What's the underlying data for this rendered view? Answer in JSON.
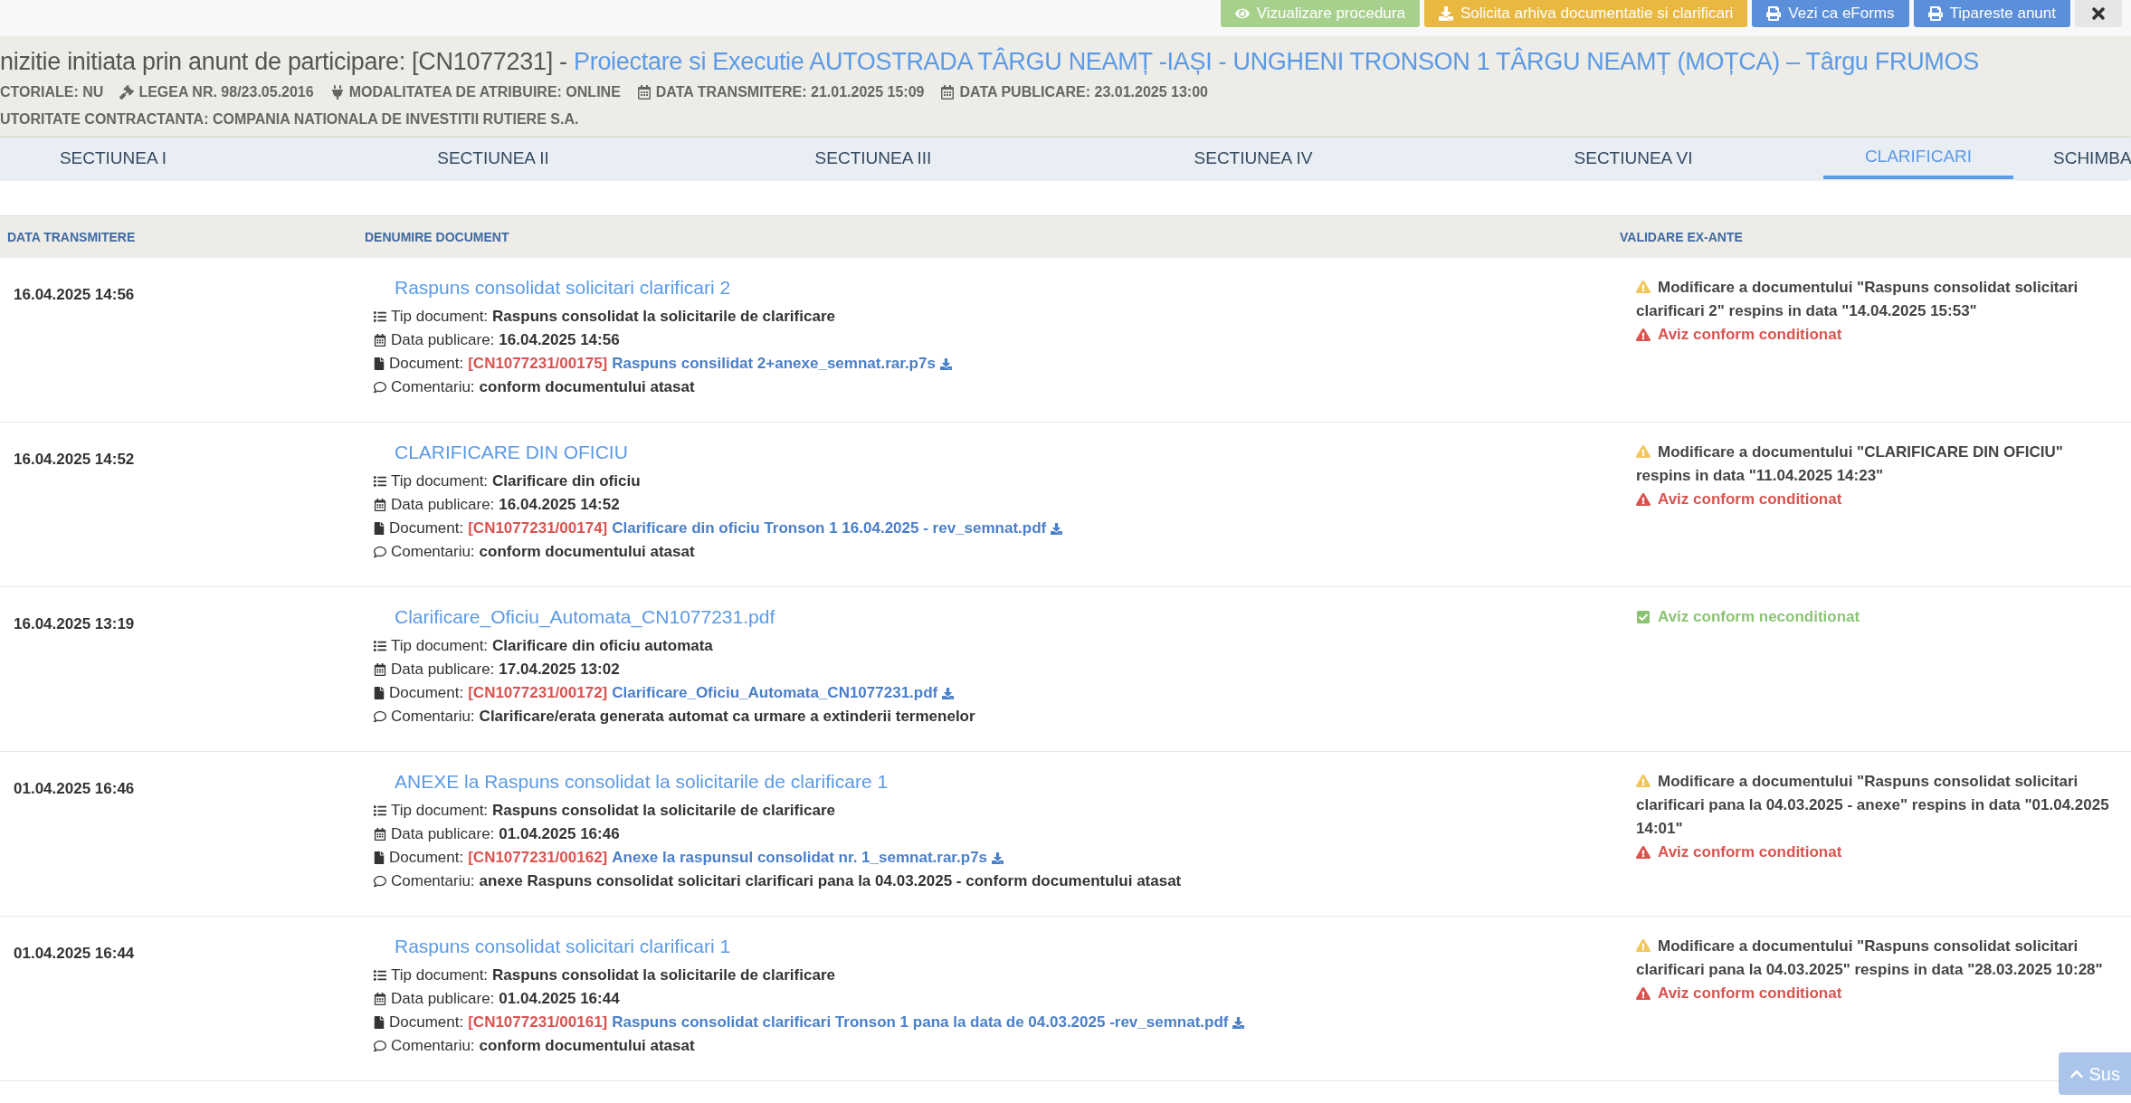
{
  "top_buttons": [
    {
      "kind": "view",
      "label": "Vizualizare procedura",
      "color": "#a8d08d"
    },
    {
      "kind": "archive",
      "label": "Solicita arhiva documentatie si clarificari",
      "color": "#e9b841"
    },
    {
      "kind": "print",
      "label": "Vezi ca eForms",
      "color": "#5b8fd9"
    },
    {
      "kind": "print",
      "label": "Tipareste anunt",
      "color": "#5b8fd9"
    },
    {
      "kind": "close",
      "color": "#e6e6e6"
    }
  ],
  "header": {
    "title_prefix": "nizitie initiata prin anunt de participare: [CN1077231] -",
    "title_link": "Proiectare si Executie AUTOSTRADA TÂRGU NEAMȚ -IAȘI - UNGHENI TRONSON 1 TÂRGU NEAMȚ (MOȚCA) – Târgu FRUMOS",
    "meta": [
      {
        "kind": "plain",
        "text": "CTORIALE: NU"
      },
      {
        "kind": "law",
        "text": "LEGEA NR. 98/23.05.2016"
      },
      {
        "kind": "plug",
        "text": "MODALITATEA DE ATRIBUIRE: ONLINE"
      },
      {
        "kind": "date",
        "text": "DATA TRANSMITERE: 21.01.2025 15:09"
      },
      {
        "kind": "date",
        "text": "DATA PUBLICARE: 23.01.2025 13:00"
      }
    ],
    "authority": "UTORITATE CONTRACTANTA: COMPANIA NATIONALA DE INVESTITII RUTIERE S.A."
  },
  "tabs": [
    {
      "label": "SECTIUNEA I",
      "selected": false
    },
    {
      "label": "SECTIUNEA II",
      "selected": false
    },
    {
      "label": "SECTIUNEA III",
      "selected": false
    },
    {
      "label": "SECTIUNEA IV",
      "selected": false
    },
    {
      "label": "SECTIUNEA VI",
      "selected": false
    },
    {
      "label": "CLARIFICARI",
      "selected": true
    },
    {
      "label": "SCHIMBA",
      "selected": false
    }
  ],
  "table": {
    "columns": [
      "DATA TRANSMITERE",
      "DENUMIRE DOCUMENT",
      "VALIDARE EX-ANTE"
    ],
    "rows": [
      {
        "date": "16.04.2025 14:56",
        "title": "Raspuns consolidat solicitari clarificari 2",
        "tip_label": "Tip document:",
        "tip": "Raspuns consolidat la solicitarile de clarificare",
        "pub_label": "Data publicare:",
        "pub": "16.04.2025 14:56",
        "doc_label": "Document:",
        "doc_code": "[CN1077231/00175]",
        "doc_name": "Raspuns consilidat 2+anexe_semnat.rar.p7s",
        "comment_label": "Comentariu:",
        "comment": "conform documentului atasat",
        "validation": [
          {
            "kind": "warning",
            "text": "Modificare a documentului \"Raspuns consolidat solicitari clarificari 2\" respins in data \"14.04.2025 15:53\""
          },
          {
            "kind": "error",
            "text": "Aviz conform conditionat"
          }
        ]
      },
      {
        "date": "16.04.2025 14:52",
        "title": "CLARIFICARE DIN OFICIU",
        "tip_label": "Tip document:",
        "tip": "Clarificare din oficiu",
        "pub_label": "Data publicare:",
        "pub": "16.04.2025 14:52",
        "doc_label": "Document:",
        "doc_code": "[CN1077231/00174]",
        "doc_name": "Clarificare din oficiu Tronson 1 16.04.2025 - rev_semnat.pdf",
        "comment_label": "Comentariu:",
        "comment": "conform documentului atasat",
        "validation": [
          {
            "kind": "warning",
            "text": "Modificare a documentului \"CLARIFICARE DIN OFICIU\" respins in data \"11.04.2025 14:23\""
          },
          {
            "kind": "error",
            "text": "Aviz conform conditionat"
          }
        ]
      },
      {
        "date": "16.04.2025 13:19",
        "title": "Clarificare_Oficiu_Automata_CN1077231.pdf",
        "tip_label": "Tip document:",
        "tip": "Clarificare din oficiu automata",
        "pub_label": "Data publicare:",
        "pub": "17.04.2025 13:02",
        "doc_label": "Document:",
        "doc_code": "[CN1077231/00172]",
        "doc_name": "Clarificare_Oficiu_Automata_CN1077231.pdf",
        "comment_label": "Comentariu:",
        "comment": "Clarificare/erata generata automat ca urmare a extinderii termenelor",
        "validation": [
          {
            "kind": "ok",
            "text": "Aviz conform neconditionat"
          }
        ]
      },
      {
        "date": "01.04.2025 16:46",
        "title": "ANEXE la Raspuns consolidat la solicitarile de clarificare 1",
        "tip_label": "Tip document:",
        "tip": "Raspuns consolidat la solicitarile de clarificare",
        "pub_label": "Data publicare:",
        "pub": "01.04.2025 16:46",
        "doc_label": "Document:",
        "doc_code": "[CN1077231/00162]",
        "doc_name": "Anexe la raspunsul consolidat nr. 1_semnat.rar.p7s",
        "comment_label": "Comentariu:",
        "comment": "anexe Raspuns consolidat solicitari clarificari pana la 04.03.2025 - conform documentului atasat",
        "validation": [
          {
            "kind": "warning",
            "text": "Modificare a documentului \"Raspuns consolidat solicitari clarificari pana la 04.03.2025 - anexe\" respins in data \"01.04.2025 14:01\""
          },
          {
            "kind": "error",
            "text": "Aviz conform conditionat"
          }
        ]
      },
      {
        "date": "01.04.2025 16:44",
        "title": "Raspuns consolidat solicitari clarificari 1",
        "tip_label": "Tip document:",
        "tip": "Raspuns consolidat la solicitarile de clarificare",
        "pub_label": "Data publicare:",
        "pub": "01.04.2025 16:44",
        "doc_label": "Document:",
        "doc_code": "[CN1077231/00161]",
        "doc_name": "Raspuns consolidat clarificari Tronson 1 pana la data de 04.03.2025 -rev_semnat.pdf",
        "comment_label": "Comentariu:",
        "comment": "conform documentului atasat",
        "validation": [
          {
            "kind": "warning",
            "text": "Modificare a documentului \"Raspuns consolidat solicitari clarificari pana la 04.03.2025\" respins in data \"28.03.2025 10:28\""
          },
          {
            "kind": "error",
            "text": "Aviz conform conditionat"
          }
        ]
      }
    ]
  },
  "scroll_top": {
    "label": "Sus"
  }
}
